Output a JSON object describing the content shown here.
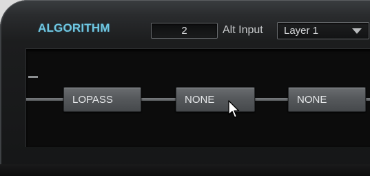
{
  "header": {
    "title": "ALGORITHM",
    "alt_input_value": "2",
    "alt_input_label": "Alt Input",
    "layer_select_value": "Layer 1"
  },
  "algorithm": {
    "stages": [
      {
        "label": "LOPASS"
      },
      {
        "label": "NONE"
      },
      {
        "label": "NONE"
      }
    ]
  },
  "colors": {
    "title_accent": "#6fc7e2",
    "panel_background": "#1c1d1e",
    "button_face": "#56595c"
  },
  "icons": {
    "cursor": "mouse-pointer-icon",
    "dropdown": "chevron-down-icon"
  }
}
